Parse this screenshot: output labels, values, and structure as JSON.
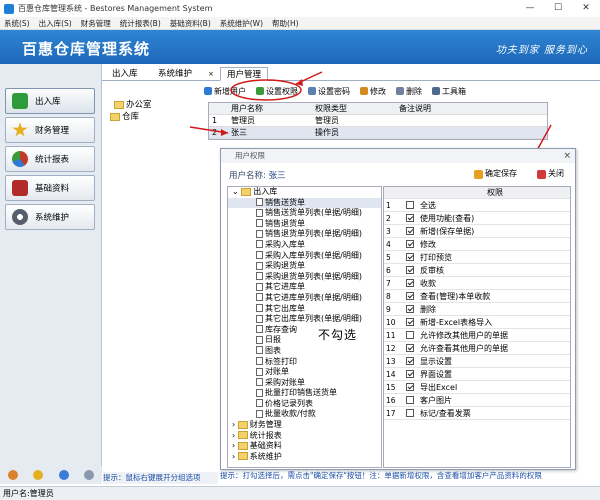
{
  "window": {
    "title": "百惠仓库管理系统 - Bestores Management System",
    "minimize": "—",
    "maximize": "☐",
    "close": "✕"
  },
  "menu": [
    "系统(S)",
    "出入库(S)",
    "财务管理",
    "统计报表(B)",
    "基础资料(B)",
    "系统维护(W)",
    "帮助(H)"
  ],
  "banner": {
    "logo": "百惠仓库管理系统",
    "slogan": "功夫到家 服务到心"
  },
  "sidebar": [
    {
      "label": "出入库",
      "color": "#2e9a3a"
    },
    {
      "label": "财务管理",
      "color": "#e5b020"
    },
    {
      "label": "统计报表",
      "color": "#c0392b"
    },
    {
      "label": "基础资料",
      "color": "#b22a2a"
    },
    {
      "label": "系统维护",
      "color": "#555e6a"
    }
  ],
  "tabs": [
    {
      "label": "出入库"
    },
    {
      "label": "系统维护"
    },
    {
      "label": "用户管理"
    }
  ],
  "tab_close": "×",
  "tree_left": {
    "root": "办公室",
    "child": "仓库"
  },
  "toolbar": [
    {
      "label": "新增用户",
      "color": "#2e7bd6"
    },
    {
      "label": "设置权限",
      "color": "#3a9a3a"
    },
    {
      "label": "设置密码",
      "color": "#5a7fb0"
    },
    {
      "label": "修改",
      "color": "#d28a1e"
    },
    {
      "label": "删除",
      "color": "#6f7fa0"
    },
    {
      "label": "工具箱",
      "color": "#4d6a8c"
    }
  ],
  "users_grid": {
    "headers": [
      "用户名称",
      "权限类型",
      "备注说明"
    ],
    "rows": [
      {
        "n": "1",
        "name": "管理员",
        "type": "管理员",
        "note": ""
      },
      {
        "n": "2",
        "name": "张三",
        "type": "操作员",
        "note": ""
      }
    ]
  },
  "dialog": {
    "title": "用户权限",
    "close": "×",
    "user_label": "用户名称:",
    "user_value": "张三",
    "save_label": "确定保存",
    "exit_label": "关闭",
    "tree": [
      {
        "t": "出入库",
        "lvl": 0,
        "folder": true
      },
      {
        "t": "销售送货单",
        "lvl": 2,
        "sel": true
      },
      {
        "t": "销售送货单列表(单据/明细)",
        "lvl": 2
      },
      {
        "t": "销售退货单",
        "lvl": 2
      },
      {
        "t": "销售退货单列表(单据/明细)",
        "lvl": 2
      },
      {
        "t": "采购入库单",
        "lvl": 2
      },
      {
        "t": "采购入库单列表(单据/明细)",
        "lvl": 2
      },
      {
        "t": "采购退货单",
        "lvl": 2
      },
      {
        "t": "采购退货单列表(单据/明细)",
        "lvl": 2
      },
      {
        "t": "其它进库单",
        "lvl": 2
      },
      {
        "t": "其它进库单列表(单据/明细)",
        "lvl": 2
      },
      {
        "t": "其它出库单",
        "lvl": 2
      },
      {
        "t": "其它出库单列表(单据/明细)",
        "lvl": 2
      },
      {
        "t": "库存查询",
        "lvl": 2
      },
      {
        "t": "日报",
        "lvl": 2
      },
      {
        "t": "图表",
        "lvl": 2
      },
      {
        "t": "标签打印",
        "lvl": 2
      },
      {
        "t": "对账单",
        "lvl": 2
      },
      {
        "t": "采购对账单",
        "lvl": 2
      },
      {
        "t": "批量打印销售送货单",
        "lvl": 2
      },
      {
        "t": "价格记录列表",
        "lvl": 2
      },
      {
        "t": "批量收款/付款",
        "lvl": 2
      },
      {
        "t": "财务管理",
        "lvl": 0,
        "folder": true
      },
      {
        "t": "统计报表",
        "lvl": 0,
        "folder": true
      },
      {
        "t": "基础资料",
        "lvl": 0,
        "folder": true
      },
      {
        "t": "系统维护",
        "lvl": 0,
        "folder": true
      }
    ],
    "perm_header": "权限",
    "perms": [
      {
        "n": "1",
        "label": "全选",
        "checked": false
      },
      {
        "n": "2",
        "label": "使用功能(查看)",
        "checked": true
      },
      {
        "n": "3",
        "label": "新增(保存单据)",
        "checked": true
      },
      {
        "n": "4",
        "label": "修改",
        "checked": true
      },
      {
        "n": "5",
        "label": "打印预览",
        "checked": true
      },
      {
        "n": "6",
        "label": "反审核",
        "checked": true
      },
      {
        "n": "7",
        "label": "收款",
        "checked": true
      },
      {
        "n": "8",
        "label": "查看(管理)本单收款",
        "checked": true
      },
      {
        "n": "9",
        "label": "删除",
        "checked": true
      },
      {
        "n": "10",
        "label": "新增-Excel表格导入",
        "checked": true
      },
      {
        "n": "11",
        "label": "允许修改其他用户的单据",
        "checked": false
      },
      {
        "n": "12",
        "label": "允许查看其他用户的单据",
        "checked": true
      },
      {
        "n": "13",
        "label": "显示设置",
        "checked": true
      },
      {
        "n": "14",
        "label": "界面设置",
        "checked": true
      },
      {
        "n": "15",
        "label": "导出Excel",
        "checked": true
      },
      {
        "n": "16",
        "label": "客户图片",
        "checked": false
      },
      {
        "n": "17",
        "label": "标记/查看发票",
        "checked": false
      }
    ]
  },
  "annotation": "不勾选",
  "hint_left": "提示：鼠标右键展开分组选项",
  "hint_dialog": "提示：打勾选择后，需点击\"确定保存\"按钮！注：单据新增权限，含查看增加客户产品资料的权限",
  "status": "用户名:管理员"
}
